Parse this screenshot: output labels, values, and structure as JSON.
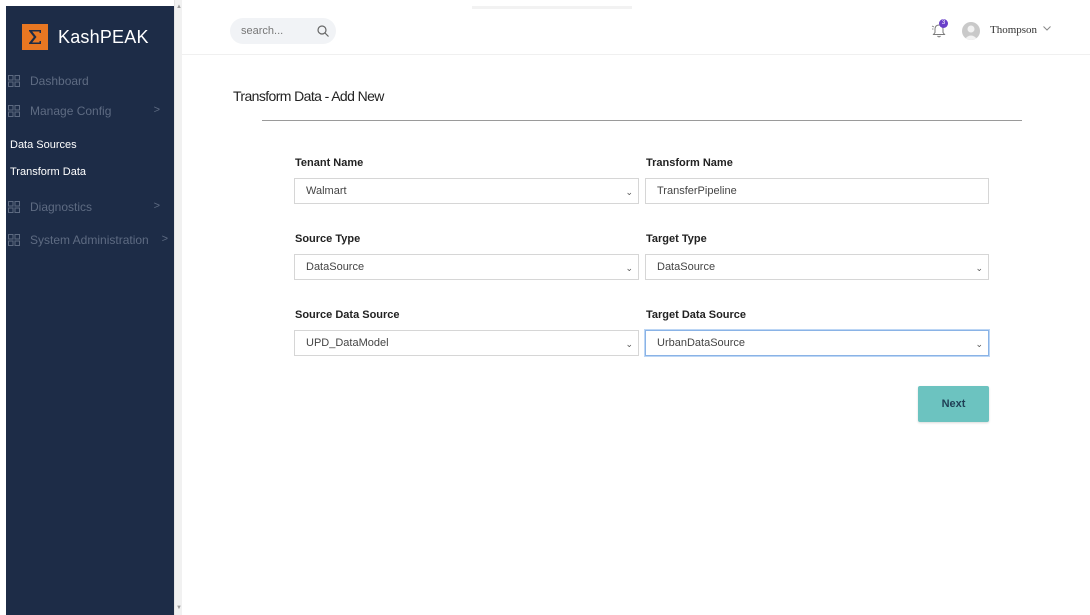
{
  "brand": {
    "name": "KashPEAK",
    "accent_color": "#e87722",
    "sidebar_color": "#1d2c47"
  },
  "sidebar": {
    "items": [
      {
        "label": "Dashboard",
        "icon": "grid-icon"
      },
      {
        "label": "Manage Config",
        "icon": "grid-icon",
        "chevron": ">"
      },
      {
        "label": "Diagnostics",
        "icon": "grid-icon",
        "chevron": ">"
      },
      {
        "label": "System Administration",
        "icon": "grid-icon",
        "chevron": ">"
      }
    ],
    "sub_items": [
      {
        "label": "Data Sources"
      },
      {
        "label": "Transform Data"
      }
    ]
  },
  "header": {
    "search_placeholder": "search...",
    "notification_count": "3",
    "user_name": "Thompson"
  },
  "page": {
    "title": "Transform Data - Add New",
    "fields": {
      "tenant_name": {
        "label": "Tenant Name",
        "value": "Walmart"
      },
      "transform_name": {
        "label": "Transform Name",
        "value": "TransferPipeline"
      },
      "source_type": {
        "label": "Source Type",
        "value": "DataSource"
      },
      "target_type": {
        "label": "Target Type",
        "value": "DataSource"
      },
      "source_data_source": {
        "label": "Source Data Source",
        "value": "UPD_DataModel"
      },
      "target_data_source": {
        "label": "Target Data Source",
        "value": "UrbanDataSource"
      }
    },
    "next_label": "Next",
    "next_color": "#6cc3c0"
  }
}
